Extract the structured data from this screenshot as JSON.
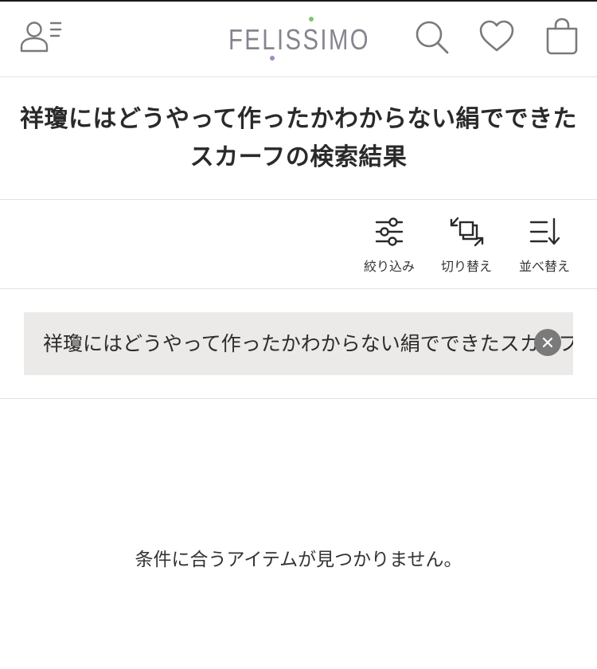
{
  "header": {
    "logo_text": "FELISSIMO",
    "icons": {
      "menu": "user-menu-icon",
      "search": "search-icon",
      "favorites": "heart-icon",
      "cart": "shopping-bag-icon"
    },
    "colors": {
      "logo": "#85858f",
      "logo_dot_green": "#7dc66f",
      "logo_dot_purple": "#a985c8"
    }
  },
  "title": {
    "text": "祥瓊にはどうやって作ったかわからない絹でできたスカーフの検索結果"
  },
  "toolbar": {
    "filter_label": "絞り込み",
    "switch_label": "切り替え",
    "sort_label": "並べ替え"
  },
  "search": {
    "keyword": "祥瓊にはどうやって作ったかわからない絹でできたスカーフ",
    "chip_color": "#eceae8"
  },
  "results": {
    "empty_message": "条件に合うアイテムが見つかりません。"
  }
}
